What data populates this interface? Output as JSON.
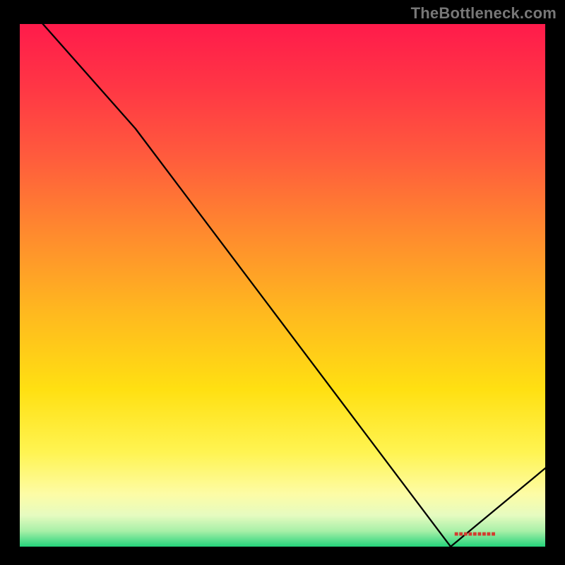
{
  "watermark": "TheBottleneck.com",
  "bottom_label": "■■■■■■■■■",
  "colors": {
    "gradient_stops": [
      {
        "offset": 0.0,
        "color": "#ff1b4b"
      },
      {
        "offset": 0.12,
        "color": "#ff3645"
      },
      {
        "offset": 0.25,
        "color": "#ff5a3d"
      },
      {
        "offset": 0.4,
        "color": "#ff8a2e"
      },
      {
        "offset": 0.55,
        "color": "#ffb81f"
      },
      {
        "offset": 0.7,
        "color": "#ffe012"
      },
      {
        "offset": 0.82,
        "color": "#fff452"
      },
      {
        "offset": 0.9,
        "color": "#fdfca6"
      },
      {
        "offset": 0.94,
        "color": "#e6fbc0"
      },
      {
        "offset": 0.97,
        "color": "#a8f0a8"
      },
      {
        "offset": 1.0,
        "color": "#24d37a"
      }
    ],
    "line": "#000000",
    "background": "#000000",
    "watermark": "#777777",
    "bottom_label": "#d33b2f"
  },
  "chart_data": {
    "type": "line",
    "title": "",
    "xlabel": "",
    "ylabel": "",
    "xlim": [
      0,
      100
    ],
    "ylim": [
      0,
      100
    ],
    "x": [
      0,
      22,
      82,
      100
    ],
    "values": [
      105,
      80,
      0,
      15
    ],
    "note": "y-values are relative percentages read off the vertical extent; the curve starts above the top edge at x≈0, has a slope break near x≈22 at y≈80, reaches the baseline near x≈82, then rises to y≈15 at x=100. Axes have no visible tick labels, so values are proportions of the plot area."
  }
}
